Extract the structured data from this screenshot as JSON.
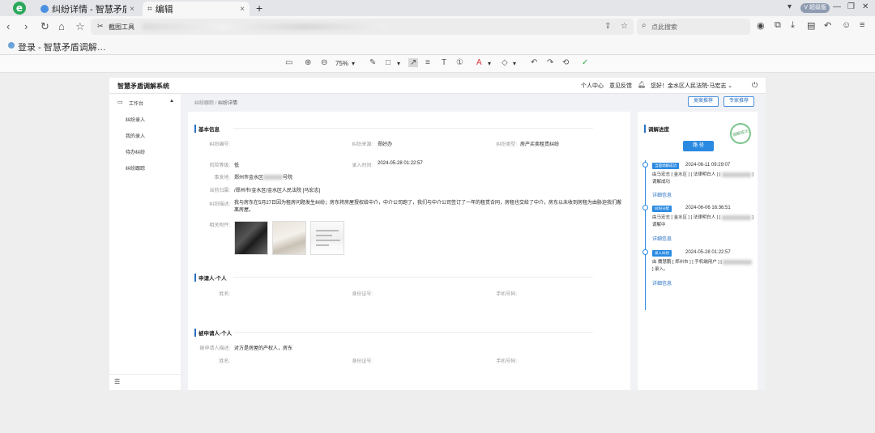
{
  "browser": {
    "logo": "e",
    "tabs": [
      {
        "label": "纠纷详情 - 智慧矛盾调解",
        "close": "×"
      },
      {
        "label": "编辑",
        "close": "×"
      }
    ],
    "newtab": "+",
    "vip_label": "V 超级版",
    "window_controls": [
      "▾",
      "—",
      "❐",
      "✕"
    ],
    "address": {
      "tool_label": "截图工具",
      "search_placeholder": "点此搜索"
    },
    "bookmark_label": "登录 - 智慧矛盾调解…"
  },
  "editor_toolbar": {
    "zoom": "75%"
  },
  "app": {
    "title": "智慧矛盾调解系统",
    "header": {
      "personal_center": "个人中心",
      "feedback": "意见反馈",
      "greeting": "您好！金水区人民法院-马宏志 ⌄"
    },
    "sidebar": {
      "section": "工作台",
      "items": [
        "纠纷录入",
        "我的录入",
        "待办纠纷",
        "纠纷跟踪"
      ]
    },
    "breadcrumb": {
      "parent": "纠纷跟踪",
      "separator": " / ",
      "current": "纠纷详情"
    },
    "top_buttons": {
      "case_recommend": "类案推荐",
      "expert_recommend": "专家推荐"
    },
    "basic_info": {
      "title": "基本信息",
      "labels": {
        "dispute_no": "纠纷编号:",
        "dispute_source": "纠纷来源:",
        "dispute_type": "纠纷类型:",
        "risk_level": "风险等级:",
        "entry_time": "录入时间:",
        "location": "事发地:",
        "current_org": "当前归属:",
        "description": "纠纷描述:",
        "attachments": "相关附件:"
      },
      "values": {
        "dispute_source": "郑好办",
        "dispute_type": "房产买卖租赁纠纷",
        "risk_level": "低",
        "entry_time": "2024-05-28 01:22:57",
        "location_prefix": "郑州市金水区",
        "location_suffix": "号院",
        "current_org": "/郑州市/金水区/金水区人民法院 [马宏志]",
        "description": "我与房东在5月27日因为租房问题发生纠纷；房东将房屋授权给中介，中介公司跑了，我们与中介公司签订了一年的租赁合同，房租也交给了中介，房东以未收到房租为由胁迫我们搬离房屋。"
      }
    },
    "applicant": {
      "title": "申请人-个人",
      "labels": {
        "name": "姓名:",
        "id_card": "身份证号:",
        "phone": "手机号码:"
      }
    },
    "respondent": {
      "title": "被申请人-个人",
      "labels": {
        "desc": "被申请人描述:",
        "name": "姓名:",
        "id_card": "身份证号:",
        "phone": "手机号码:"
      },
      "values": {
        "desc": "对方是房屋的产权人，房东"
      }
    },
    "progress": {
      "title": "调解进度",
      "stamp": "调解成功",
      "button": "路 径",
      "timeline": [
        {
          "tag": "当面调解成功",
          "time": "2024-06-11 09:29:07",
          "text": "由马宏志 [ 金水区 ] [ 法律明白人 ] [ ",
          "text_tail": " ] 调解成功",
          "link": "详细信息"
        },
        {
          "tag": "纠纷分配",
          "time": "2024-06-06 16:36:51",
          "text": "由马宏志 [ 金水区 ] [ 法律明白人 ] [ ",
          "text_tail": " ] 调解中",
          "link": "详细信息"
        },
        {
          "tag": "录入纠纷",
          "time": "2024-05-28 01:22:57",
          "text": "由 魏慧鹏 [ 郑州市 ] [ 手机端用户 ] [ ",
          "text_tail": " ] 录入。",
          "link": "详细信息"
        }
      ]
    }
  }
}
